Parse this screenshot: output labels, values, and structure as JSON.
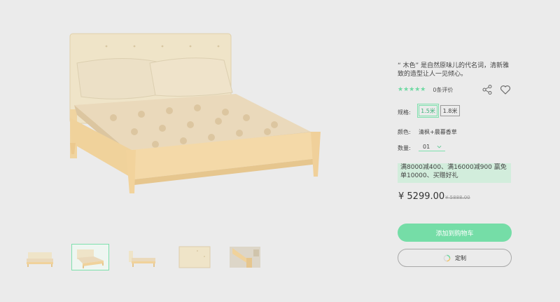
{
  "product": {
    "description": "“ 木色” 是自然原味儿的代名词，清新雅致的造型让人一见倾心。",
    "rating_stars": "★★★★★",
    "reviews_label": "0条评价",
    "size_label": "规格:",
    "sizes": [
      "1.5米",
      "1.8米"
    ],
    "selected_size": "1.5米",
    "color_label": "颜色:",
    "color_value": "清枫+晨暮香草",
    "quantity_label": "数量:",
    "quantity_value": "01",
    "promo_text": "满8000减400、满16000减900 赢免单10000、买赠好礼",
    "price": "¥ 5299.00",
    "original_price": "¥ 5888.00",
    "add_to_cart_label": "添加到购物车",
    "customize_label": "定制"
  },
  "gallery": {
    "thumbnails": [
      "bed-front-view",
      "bed-angle-view",
      "bed-side-view",
      "headboard-detail",
      "leg-detail"
    ],
    "active_index": 1
  },
  "colors": {
    "accent": "#75dda7",
    "accent_border": "#7ee0ad",
    "promo_bg": "#d2eddc",
    "wood": "#f3d7a4",
    "fabric": "#efe3c9",
    "bedding": "#e8d7bd"
  },
  "icons": {
    "share": "share-icon",
    "favorite": "heart-icon",
    "quantity_dropdown": "chevron-down-icon",
    "customize": "loading-spinner-icon"
  }
}
